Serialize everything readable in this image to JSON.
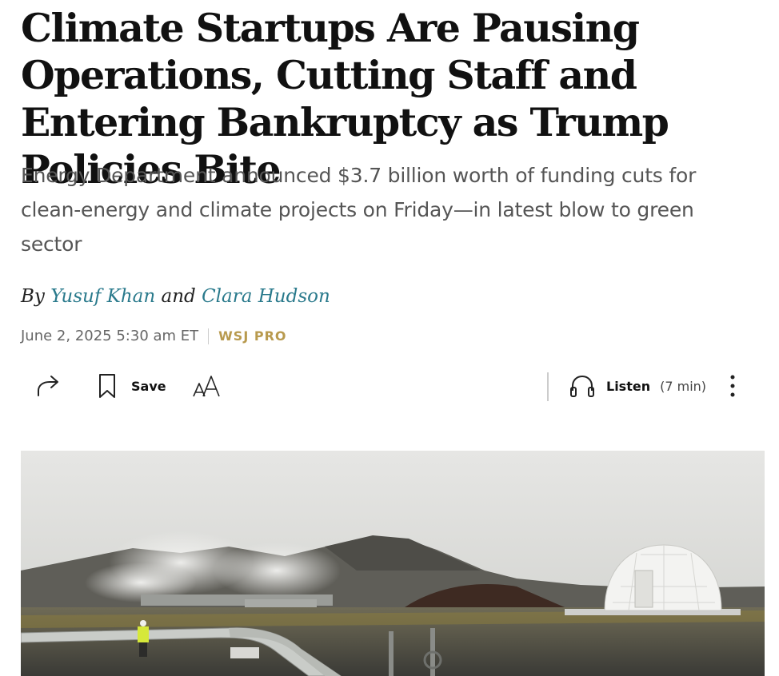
{
  "article": {
    "headline": "Climate Startups Are Pausing Operations, Cutting Staff and Entering Bankruptcy as Trump Policies Bite",
    "dek": "Energy Department announced $3.7 billion worth of funding cuts for clean-energy and climate projects on Friday—in latest blow to green sector",
    "byline": {
      "prefix": "By",
      "author1": "Yusuf Khan",
      "conjunction": "and",
      "author2": "Clara Hudson"
    },
    "date": "June 2, 2025 5:30 am ET",
    "section_badge": "WSJ PRO"
  },
  "toolbar": {
    "share_icon": "share-icon",
    "save_icon": "bookmark-icon",
    "save_label": "Save",
    "text_size_icon": "text-size-icon",
    "text_size_glyph": "AA",
    "listen_icon": "headphones-icon",
    "listen_label": "Listen",
    "listen_duration": "(7 min)",
    "more_icon": "more-vertical-icon"
  },
  "colors": {
    "author_link": "#2a7a8c",
    "badge": "#b89a4e",
    "dek": "#555555"
  }
}
